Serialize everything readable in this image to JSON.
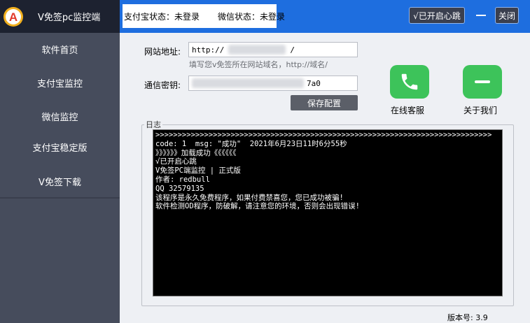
{
  "app": {
    "title": "V免签pc监控端",
    "logo_letter": "A"
  },
  "sidebar": {
    "items": [
      {
        "label": "软件首页"
      },
      {
        "label": "支付宝监控"
      },
      {
        "label": "微信监控"
      },
      {
        "label": "支付宝稳定版"
      },
      {
        "label": "V免签下载"
      }
    ]
  },
  "header": {
    "alipay_status": "支付宝状态：未登录",
    "wechat_status": "微信状态：未登录",
    "heartbeat_label": "√已开启心跳",
    "close_label": "关闭"
  },
  "form": {
    "site_label": "网站地址:",
    "site_prefix": "http://",
    "site_suffix": "/",
    "site_hint": "填写您v免签所在网站域名，http://域名/",
    "key_label": "通信密钥:",
    "key_suffix": "7a0",
    "save_label": "保存配置"
  },
  "services": {
    "support_label": "在线客服",
    "about_label": "关于我们"
  },
  "log": {
    "title": "日志",
    "lines": [
      ">>>>>>>>>>>>>>>>>>>>>>>>>>>>>>>>>>>>>>>>>>>>>>>>>>>>>>>>>>>>>>>>>>>>>>>>>>>>",
      "code: 1  msg: \"成功\"  2021年6月23日11时6分55秒",
      "》》》》》》加载成功《《《《《《",
      "√已开启心跳",
      "V免签PC端监控 | 正式版",
      "作者: redbull",
      "QQ 32579135",
      "该程序是永久免费程序，如果付费禁喜您，您已成功被骗!",
      "软件检测OD程序，防破解，请注意您的环境，否则会出现错误!"
    ]
  },
  "footer": {
    "version": "版本号: 3.9"
  },
  "colors": {
    "header_blue": "#1e6edf",
    "sidebar_bg": "#464c5c",
    "brand_bg": "#1d2230",
    "service_green": "#3dc35a"
  },
  "icons": {
    "logo": "logo-icon",
    "support": "phone-icon",
    "about": "chat-bubble-icon"
  }
}
